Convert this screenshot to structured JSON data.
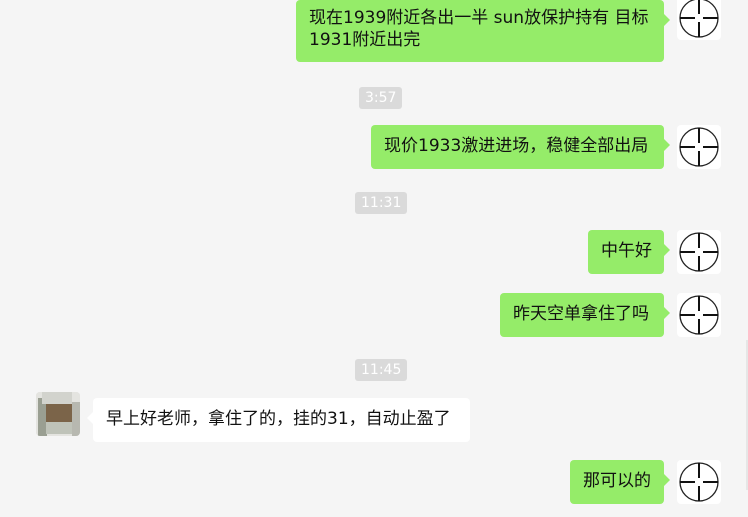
{
  "chat": {
    "messages": [
      {
        "kind": "text",
        "from": "me",
        "text_line1": "现在1939附近各出一半 sun放保护持有 目标",
        "text_line2": "1931附近出完"
      },
      {
        "kind": "time",
        "text": "3:57"
      },
      {
        "kind": "text",
        "from": "me",
        "text": "现价1933激进进场，稳健全部出局"
      },
      {
        "kind": "time",
        "text": "11:31"
      },
      {
        "kind": "text",
        "from": "me",
        "text": "中午好"
      },
      {
        "kind": "text",
        "from": "me",
        "text": "昨天空单拿住了吗"
      },
      {
        "kind": "time",
        "text": "11:45"
      },
      {
        "kind": "text",
        "from": "them",
        "text": "早上好老师，拿住了的，挂的31，自动止盈了"
      },
      {
        "kind": "text",
        "from": "me",
        "text": "那可以的"
      }
    ]
  },
  "avatars": {
    "me_icon": "crosshair-icon",
    "them_icon": "blurred-photo-avatar"
  },
  "colors": {
    "background": "#f5f5f5",
    "my_bubble": "#95ec69",
    "their_bubble": "#ffffff",
    "time_badge": "#dadada"
  }
}
